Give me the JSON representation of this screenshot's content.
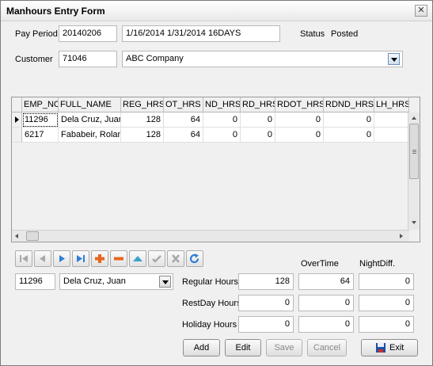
{
  "window": {
    "title": "Manhours Entry Form",
    "close_glyph": "✕"
  },
  "header": {
    "pay_period_label": "Pay Period",
    "pay_period_code": "20140206",
    "pay_period_desc": "1/16/2014 1/31/2014 16DAYS",
    "status_label": "Status",
    "status_value": "Posted",
    "customer_label": "Customer",
    "customer_code": "71046",
    "customer_name": "ABC Company"
  },
  "grid": {
    "columns": [
      "EMP_NO",
      "FULL_NAME",
      "REG_HRS",
      "OT_HRS",
      "ND_HRS",
      "RD_HRS",
      "RDOT_HRS",
      "RDND_HRS",
      "LH_HRS"
    ],
    "rows": [
      [
        "11296",
        "Dela Cruz, Juan",
        "128",
        "64",
        "0",
        "0",
        "0",
        "0",
        ""
      ],
      [
        "6217",
        "Fababeir, Rolan",
        "128",
        "64",
        "0",
        "0",
        "0",
        "0",
        ""
      ]
    ]
  },
  "navigator": {
    "icons": [
      "first-record-icon",
      "prior-record-icon",
      "next-record-icon",
      "last-record-icon",
      "insert-record-icon",
      "delete-record-icon",
      "edit-record-icon",
      "post-record-icon",
      "cancel-record-icon",
      "refresh-record-icon"
    ]
  },
  "detail": {
    "emp_no": "11296",
    "emp_name": "Dela Cruz, Juan",
    "col_overtime": "OverTime",
    "col_nightdiff": "NightDiff.",
    "regular_label": "Regular Hours",
    "restday_label": "RestDay Hours",
    "holiday_label": "Holiday Hours",
    "regular": [
      "128",
      "64",
      "0"
    ],
    "restday": [
      "0",
      "0",
      "0"
    ],
    "holiday": [
      "0",
      "0",
      "0"
    ]
  },
  "buttons": {
    "add": "Add",
    "edit": "Edit",
    "save": "Save",
    "cancel": "Cancel",
    "exit": "Exit"
  },
  "colors": {
    "nav_blue": "#2f7fd6",
    "nav_orange": "#e8661c",
    "nav_teal": "#3aa3c9",
    "nav_disabled": "#a8a8a8"
  }
}
